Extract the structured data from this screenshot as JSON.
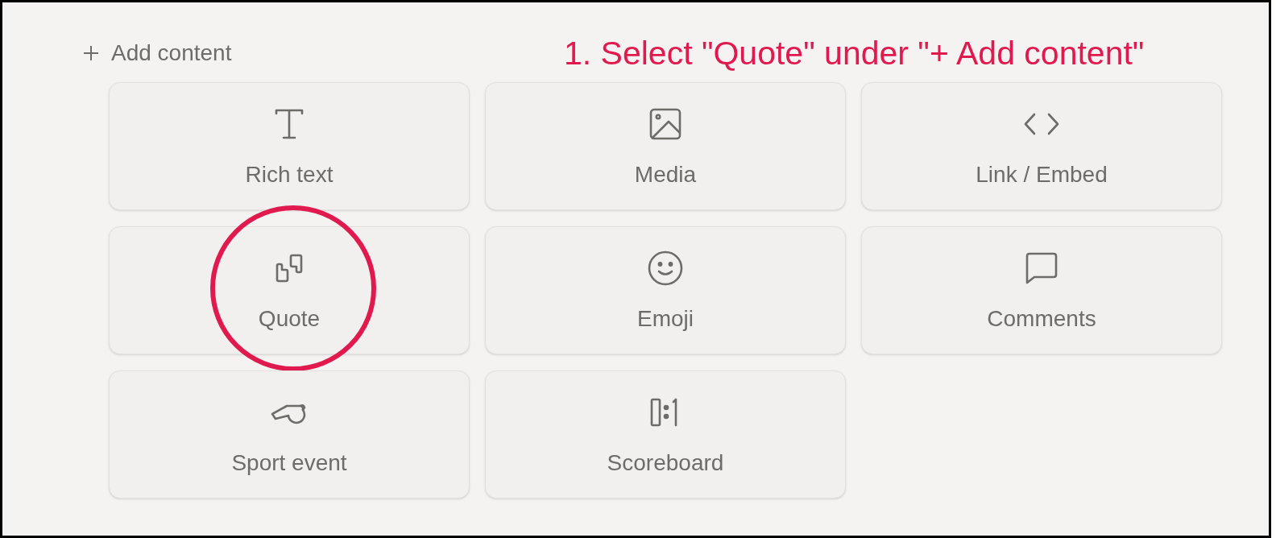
{
  "header": {
    "label": "Add content"
  },
  "annotation": {
    "text": "1. Select \"Quote\" under \"+ Add content\""
  },
  "options": [
    {
      "label": "Rich text",
      "kind": "text",
      "highlighted": false
    },
    {
      "label": "Media",
      "kind": "media",
      "highlighted": false
    },
    {
      "label": "Link / Embed",
      "kind": "embed",
      "highlighted": false
    },
    {
      "label": "Quote",
      "kind": "quote",
      "highlighted": true
    },
    {
      "label": "Emoji",
      "kind": "emoji",
      "highlighted": false
    },
    {
      "label": "Comments",
      "kind": "comments",
      "highlighted": false
    },
    {
      "label": "Sport event",
      "kind": "sport",
      "highlighted": false
    },
    {
      "label": "Scoreboard",
      "kind": "scoreboard",
      "highlighted": false
    }
  ]
}
